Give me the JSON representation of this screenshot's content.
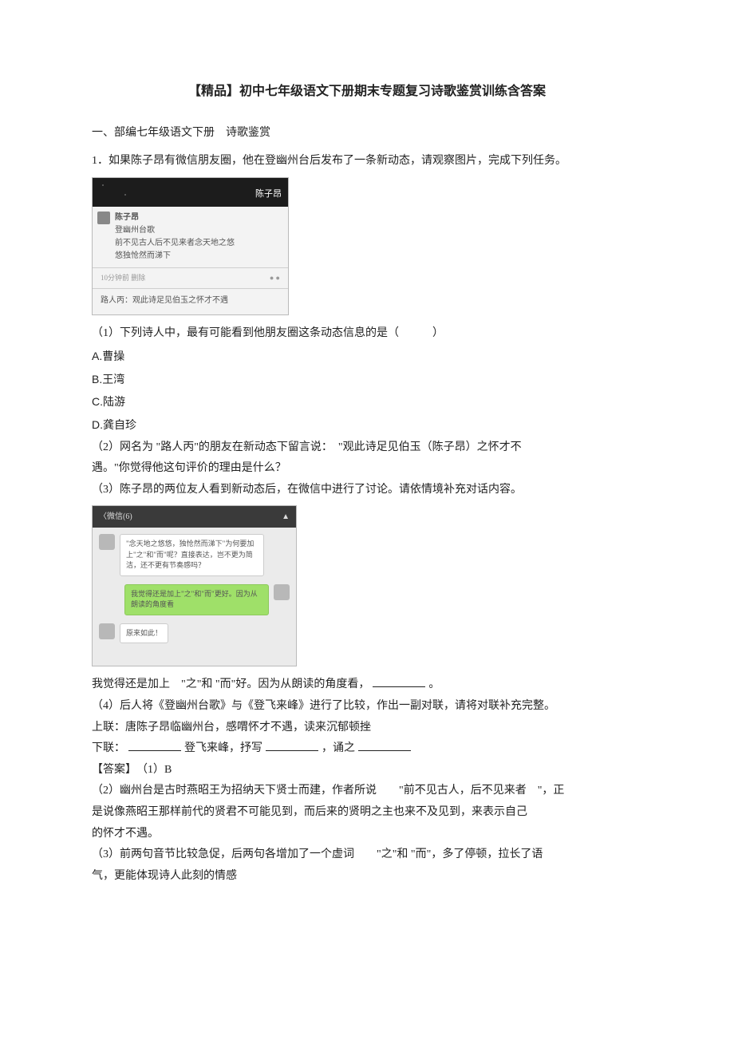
{
  "title": "【精品】初中七年级语文下册期末专题复习诗歌鉴赏训练含答案",
  "section_header": "一、部编七年级语文下册　诗歌鉴赏",
  "q1_intro": "1．如果陈子昂有微信朋友圈，他在登幽州台后发布了一条新动态，请观察图片，完成下列任务。",
  "ff": {
    "handle": "陈子昂",
    "name": "陈子昂",
    "line1": "登幽州台歌",
    "line2": "前不见古人后不见来者念天地之悠",
    "line3": "悠独怆然而涕下",
    "meta": "10分钟前  删除",
    "comment": "路人丙：观此诗足见伯玉之怀才不遇"
  },
  "q1_1": "（1）下列诗人中，最有可能看到他朋友圈这条动态信息的是（　　　）",
  "options": {
    "A": "A.曹操",
    "B": "B.王湾",
    "C": "C.陆游",
    "D": "D.龚自珍"
  },
  "q1_2a": "（2）网名为 \"路人丙\"的朋友在新动态下留言说：　\"观此诗足见伯玉（陈子昂）之怀才不",
  "q1_2b": "遇。\"你觉得他这句评价的理由是什么？",
  "q1_3": "（3）陈子昂的两位友人看到新动态后，在微信中进行了讨论。请依情境补充对话内容。",
  "chat": {
    "header": "〈微信(6)",
    "b1": "\"念天地之悠悠，独怆然而涕下\"为何要加上\"之\"和\"而\"呢？直接表达，岂不更为简洁，还不更有节奏感吗？",
    "b2": "我觉得还是加上\"之\"和\"而\"更好。因为从朗读的角度看",
    "b3": "原来如此！"
  },
  "q1_3_tail_a": "我觉得还是加上　\"之\"和 \"而\"好。因为从朗读的角度看，",
  "q1_3_tail_b": "。",
  "q1_4a": "（4）后人将《登幽州台歌》与《登飞来峰》进行了比较，作出一副对联，请将对联补充完整。",
  "q1_4b": "上联：唐陈子昂临幽州台，感喟怀才不遇，读来沉郁顿挫",
  "q1_4c_pre": "下联：",
  "q1_4c_mid1": "登飞来峰，抒写",
  "q1_4c_mid2": "，诵之",
  "ans_h": "【答案】　（1）B",
  "ans2a": "（2）幽州台是古时燕昭王为招纳天下贤士而建，作者所说　　\"前不见古人，后不见来者　\"，正",
  "ans2b": "是说像燕昭王那样前代的贤君不可能见到，而后来的贤明之主也来不及见到，来表示自己",
  "ans2c": "的怀才不遇。",
  "ans3a": "（3）前两句音节比较急促，后两句各增加了一个虚词　　\"之\"和 \"而\"，多了停顿，拉长了语",
  "ans3b": "气，更能体现诗人此刻的情感"
}
